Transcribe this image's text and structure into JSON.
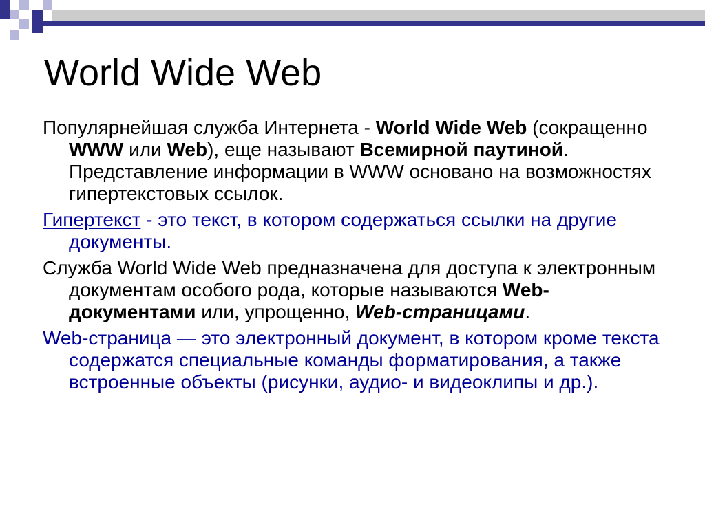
{
  "slide": {
    "title": "World Wide Web",
    "colors": {
      "navy": "#33338C",
      "lavender": "#B7B7DC",
      "gray_bar": "#CCCCCC",
      "text_blue": "#000099"
    },
    "p1": {
      "t1": "Популярнейшая служба Интернета - ",
      "b1": "World Wide Web",
      "t2": " (сокращенно ",
      "b2": "WWW",
      "t3": " или ",
      "b3": "Web",
      "t4": "), еще называют ",
      "b4": "Всемирной паутиной",
      "t5": ". Представление информации в WWW основано на возможностях гипертекстовых ссылок."
    },
    "p2": {
      "link": "Гипертекст",
      "t1": " - это текст, в котором содержаться ссылки на другие документы."
    },
    "p3": {
      "t1": "Служба World Wide Web предназначена для доступа к электронным документам особого рода, которые называются ",
      "b1": "Web-документами",
      "t2": " или, упрощенно, ",
      "bi1": "Web-страницами",
      "t3": "."
    },
    "p4": {
      "t1": "Web-страница — это электронный документ, в котором кроме текста содержатся специальные команды форматирования, а также встроенные объекты (рисунки, аудио- и видеоклипы и др.)."
    }
  }
}
